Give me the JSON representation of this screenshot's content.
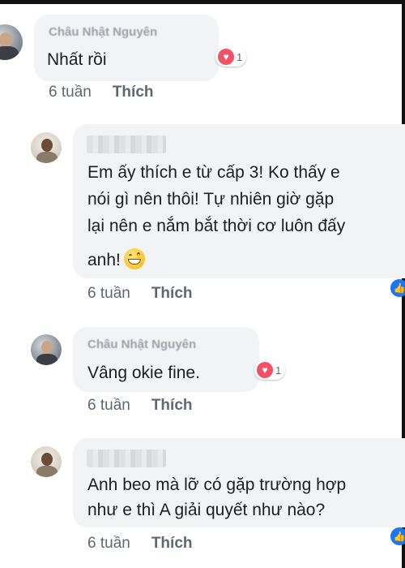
{
  "comments": [
    {
      "author": "Châu Nhật Nguyên",
      "lines": [
        "Nhất rồi"
      ],
      "reaction": {
        "icon": "heart-icon",
        "count": "1"
      },
      "time": "6 tuần",
      "like_label": "Thích"
    },
    {
      "author": "",
      "lines": [
        "Em ấy thích e từ cấp 3! Ko thấy e",
        "nói gì nên thôi! Tự nhiên giờ gặp",
        "lại nên e nắm bắt thời cơ luôn đấy",
        "anh!"
      ],
      "reaction": {
        "icon": "like-icon"
      },
      "time": "6 tuần",
      "like_label": "Thích"
    },
    {
      "author": "Châu Nhật Nguyên",
      "lines": [
        "Vâng okie fine."
      ],
      "reaction": {
        "icon": "heart-icon",
        "count": "1"
      },
      "time": "6 tuần",
      "like_label": "Thích"
    },
    {
      "author": "",
      "lines": [
        "Anh beo mà lỡ có gặp trường hợp",
        "như e thì A giải quyết như nào?"
      ],
      "reaction": {
        "icon": "like-icon"
      },
      "time": "6 tuần",
      "like_label": "Thích"
    }
  ],
  "colors": {
    "bubble": "#f2f3f5",
    "heart": "#f25268",
    "like": "#1877f2",
    "meta": "#606770"
  }
}
